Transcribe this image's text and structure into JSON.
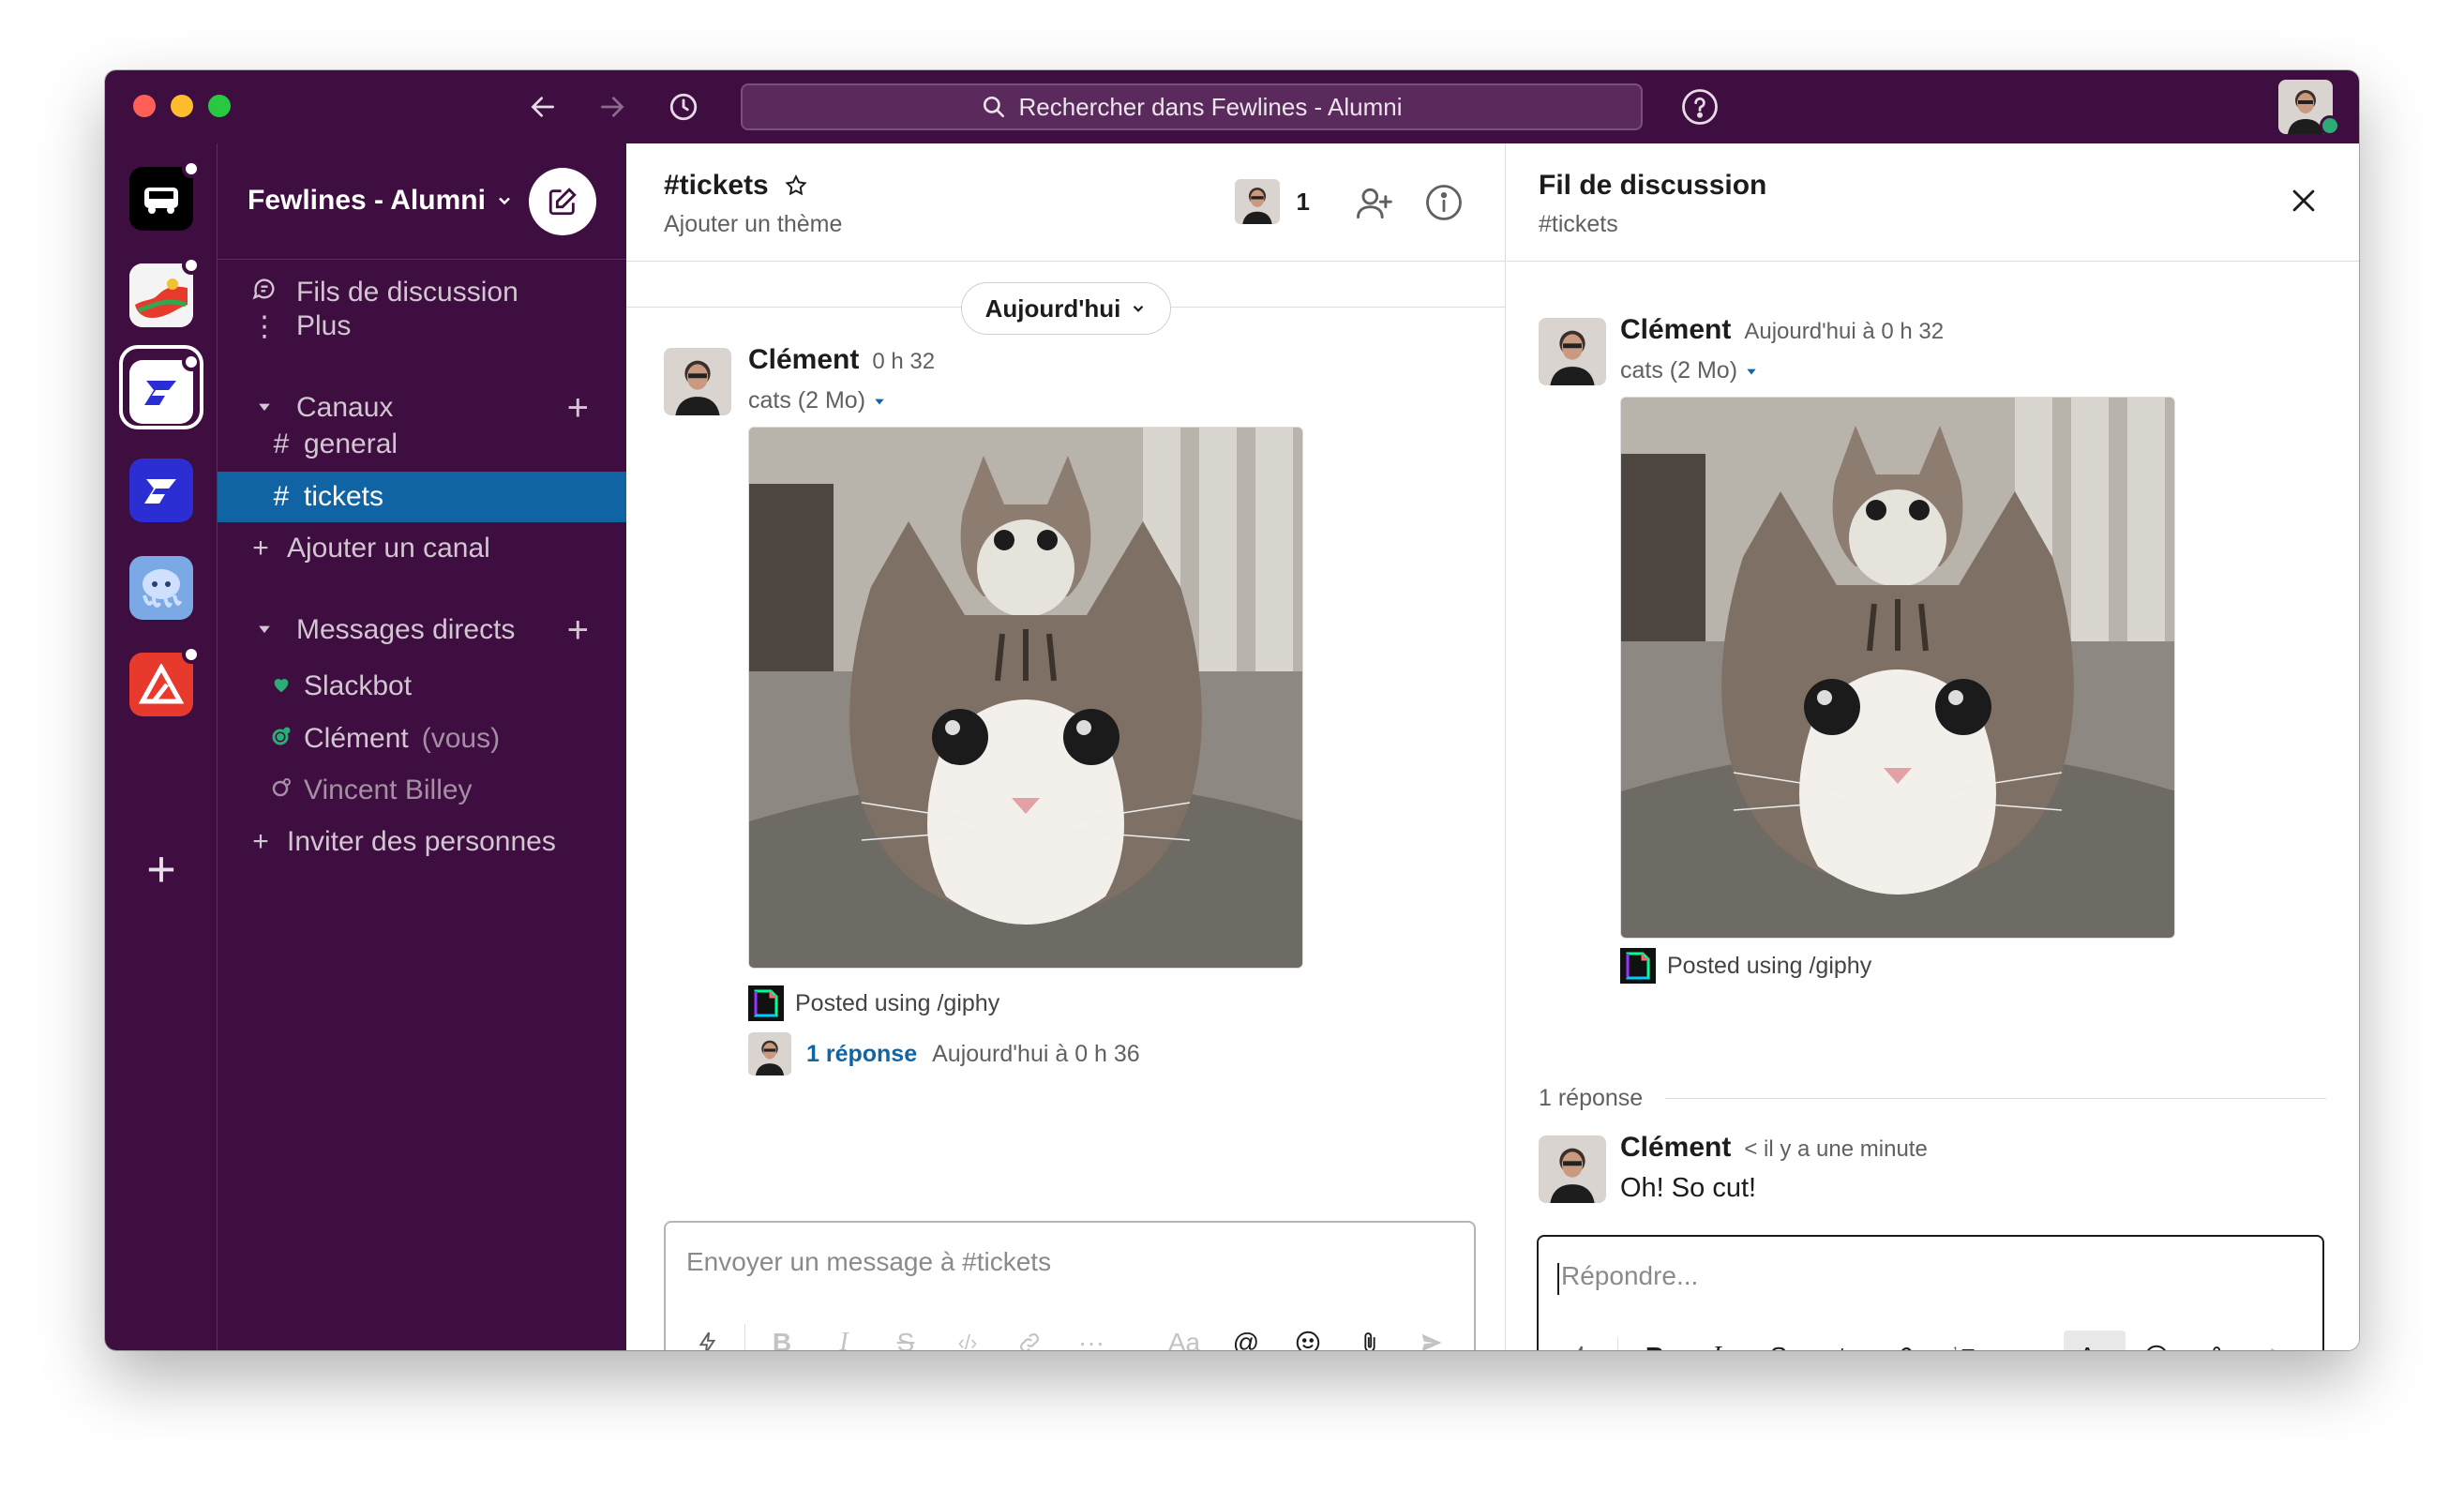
{
  "titlebar": {
    "search_placeholder": "Rechercher dans Fewlines - Alumni"
  },
  "workspace": {
    "name": "Fewlines - Alumni"
  },
  "sidebar": {
    "threads_label": "Fils de discussion",
    "more_label": "Plus",
    "channels_section": "Canaux",
    "channels": [
      {
        "name": "general",
        "active": false
      },
      {
        "name": "tickets",
        "active": true
      }
    ],
    "add_channel": "Ajouter un canal",
    "dm_section": "Messages directs",
    "dms": [
      {
        "name": "Slackbot",
        "suffix": ""
      },
      {
        "name": "Clément",
        "suffix": "(vous)"
      },
      {
        "name": "Vincent Billey",
        "suffix": ""
      }
    ],
    "invite": "Inviter des personnes"
  },
  "channel": {
    "title": "#tickets",
    "topic": "Ajouter un thème",
    "member_count": "1",
    "date_divider": "Aujourd'hui",
    "message": {
      "author": "Clément",
      "time": "0 h 32",
      "file": "cats (2 Mo)",
      "giphy": "Posted using /giphy",
      "reply_link": "1 réponse",
      "reply_time": "Aujourd'hui à 0 h 36"
    },
    "composer_placeholder": "Envoyer un message à #tickets"
  },
  "thread": {
    "title": "Fil de discussion",
    "subtitle": "#tickets",
    "parent": {
      "author": "Clément",
      "time": "Aujourd'hui à 0 h 32",
      "file": "cats (2 Mo)",
      "giphy": "Posted using /giphy"
    },
    "reply_count": "1 réponse",
    "reply": {
      "author": "Clément",
      "time": "< il y a une minute",
      "text": "Oh! So cut!"
    },
    "composer_placeholder": "Répondre..."
  },
  "toolbar": {
    "text_format": "Aa"
  },
  "colors": {
    "aubergine": "#3f0e40",
    "active_channel": "#1164a3",
    "link": "#1264a3",
    "presence": "#2bac76"
  }
}
